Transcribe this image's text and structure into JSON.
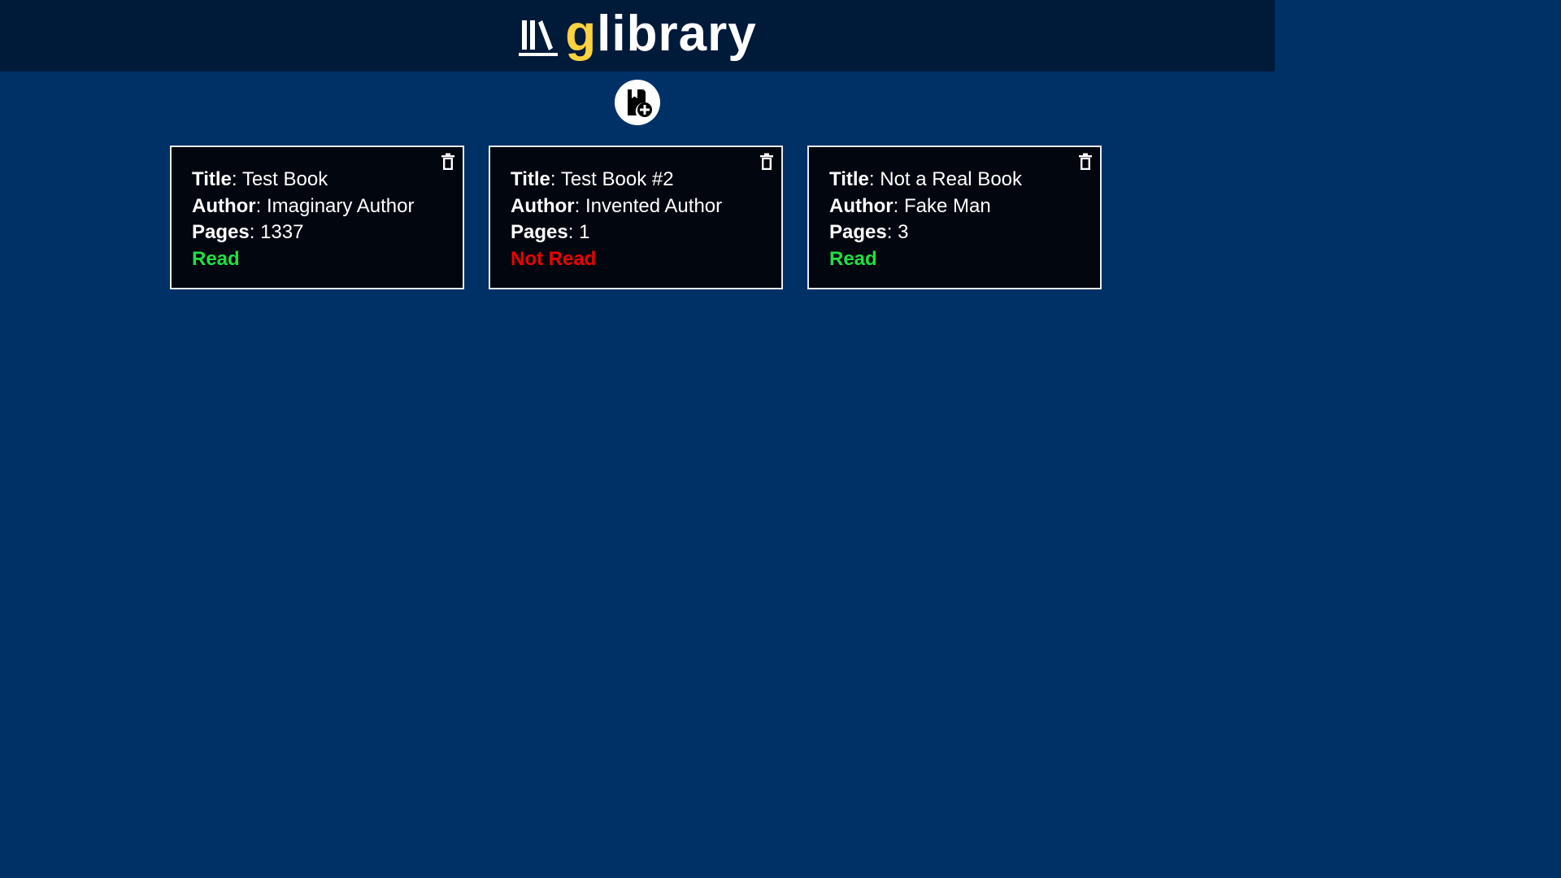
{
  "app": {
    "logo_prefix": "g",
    "logo_suffix": "library",
    "logo_icon": "books-icon",
    "accent_color": "#ffd23f",
    "add_button_icon": "add-book-icon"
  },
  "labels": {
    "title": "Title",
    "author": "Author",
    "pages": "Pages",
    "separator": ": "
  },
  "books": [
    {
      "title": "Test Book",
      "author": "Imaginary Author",
      "pages": "1337",
      "status": "Read",
      "status_color": "#1ee043",
      "delete_icon": "trash-icon"
    },
    {
      "title": "Test Book #2",
      "author": "Invented Author",
      "pages": "1",
      "status": "Not Read",
      "status_color": "#ee0000",
      "delete_icon": "trash-icon"
    },
    {
      "title": "Not a Real Book",
      "author": "Fake Man",
      "pages": "3",
      "status": "Read",
      "status_color": "#1ee043",
      "delete_icon": "trash-icon"
    }
  ]
}
